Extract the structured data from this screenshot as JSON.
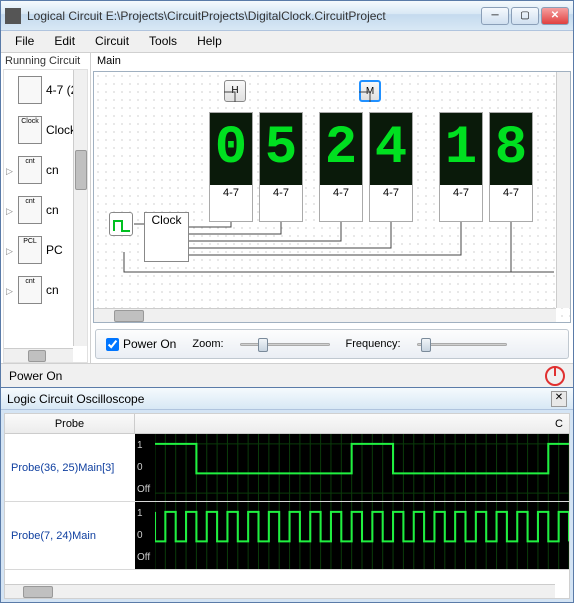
{
  "window": {
    "title": "Logical Circuit E:\\Projects\\CircuitProjects\\DigitalClock.CircuitProject"
  },
  "menu": {
    "file": "File",
    "edit": "Edit",
    "circuit": "Circuit",
    "tools": "Tools",
    "help": "Help"
  },
  "sidebar": {
    "title": "Running Circuit",
    "items": [
      {
        "label": "4-7 (2",
        "chip": ""
      },
      {
        "label": "Clock",
        "chip": "Clock"
      },
      {
        "label": "cn",
        "chip": "cnt"
      },
      {
        "label": "cn",
        "chip": "cnt"
      },
      {
        "label": "PC",
        "chip": "PCL"
      },
      {
        "label": "cn",
        "chip": "cnt"
      }
    ]
  },
  "canvas": {
    "title": "Main",
    "tags": {
      "h": "H",
      "m": "M"
    },
    "digits": [
      "0",
      "5",
      "2",
      "4",
      "1",
      "8"
    ],
    "seg_label": "4-7",
    "clock_label": "Clock"
  },
  "controls": {
    "power_label": "Power On",
    "power_checked": true,
    "zoom_label": "Zoom:",
    "freq_label": "Frequency:"
  },
  "status": {
    "text": "Power On"
  },
  "oscilloscope": {
    "title": "Logic Circuit Oscilloscope",
    "col_probe": "Probe",
    "col_c": "C",
    "labels": {
      "one": "1",
      "zero": "0",
      "off": "Off"
    },
    "probes": [
      {
        "name": "Probe(36, 25)Main[3]"
      },
      {
        "name": "Probe(7, 24)Main"
      }
    ]
  }
}
